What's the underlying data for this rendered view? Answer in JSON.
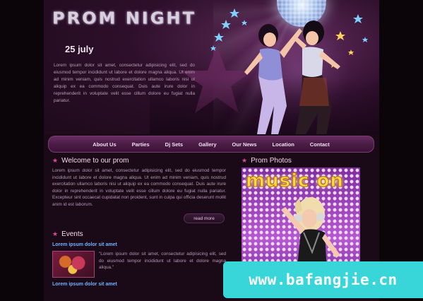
{
  "site": {
    "logo_text": "PROM NIGHT",
    "date": "25 july",
    "intro": "Lorem ipsum dolor sit amet, consectetur adipisicing elit, sed do eiusmod tempor incididunt ut labore et dolore magna aliqua. Ut enim ad minim veniam, quis nostrud exercitation ullamco laboris nisi ut aliquip ex ea commodo consequat. Duis aute irure dolor in reprehenderit in voluptate velit esse cillum dolore eu fugiat nulla pariatur."
  },
  "nav": {
    "items": [
      "About Us",
      "Parties",
      "Dj Sets",
      "Gallery",
      "Our News",
      "Location",
      "Contact"
    ]
  },
  "welcome": {
    "title": "Welcome to our prom",
    "text": "Lorem ipsum dolor sit amet, consectetur adipisicing elit, sed do eiusmod tempor incididunt ut labore et dolore magna aliqua. Ut enim ad minim veniam, quis nostrud exercitation ullamco laboris nisi ut aliquip ex ea commodo consequat. Duis aute irure dolor in reprehenderit in voluptate velit esse cillum dolore eu fugiat nulla pariatur. Excepteur sint occaecat cupidatat non proident, sunt in culpa qui officia deserunt mollit anim id est laborum.",
    "read_more": "read more"
  },
  "events": {
    "title": "Events",
    "items": [
      {
        "heading": "Lorem ipsum dolor sit amet",
        "text": "\"Lorem ipsum dolor sit amet, consectetur adipisicing elit, sed do eiusmod tempor incididunt ut labore et dolore magna aliqua.\""
      },
      {
        "heading": "Lorem ipsum dolor sit amet",
        "text": ""
      }
    ]
  },
  "photos": {
    "title": "Prom Photos",
    "image_text": "music on"
  },
  "watermark": {
    "text": "www.bafangjie.cn"
  },
  "colors": {
    "accent": "#e0459f",
    "link": "#6fb3ff",
    "background": "#1a0a17",
    "watermark_bg": "#38d6d8"
  },
  "icons": {
    "section_bullet": "star-icon"
  }
}
